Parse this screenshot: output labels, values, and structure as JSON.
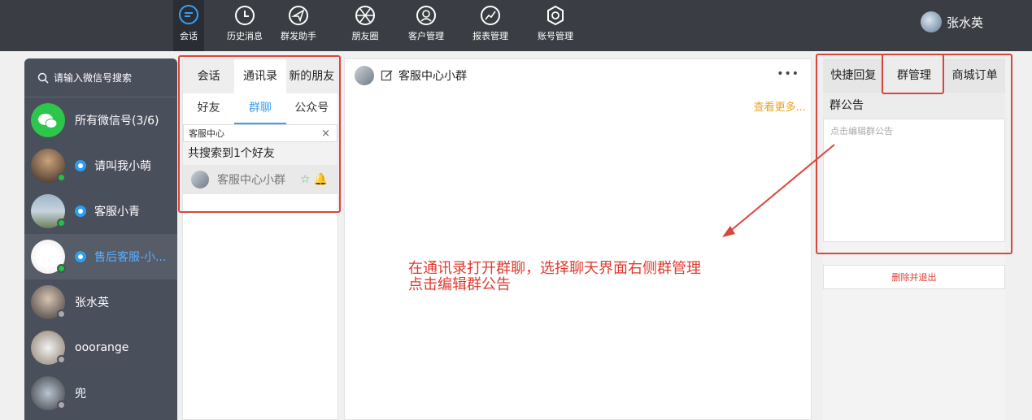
{
  "nav": {
    "items": [
      {
        "label": "会话",
        "icon": "chat-bubble-icon"
      },
      {
        "label": "历史消息",
        "icon": "clock-icon"
      },
      {
        "label": "群发助手",
        "icon": "send-icon"
      },
      {
        "label": "朋友圈",
        "icon": "aperture-icon"
      },
      {
        "label": "客户管理",
        "icon": "customer-icon"
      },
      {
        "label": "报表管理",
        "icon": "chart-icon"
      },
      {
        "label": "账号管理",
        "icon": "gear-icon"
      }
    ],
    "user_name": "张水英"
  },
  "sidebar": {
    "search_placeholder": "请输入微信号搜索",
    "accounts": [
      {
        "name": "所有微信号(3/6)"
      },
      {
        "name": "请叫我小萌"
      },
      {
        "name": "客服小青"
      },
      {
        "name": "售后客服-小..."
      },
      {
        "name": "张水英"
      },
      {
        "name": "ooorange"
      },
      {
        "name": "兜"
      }
    ]
  },
  "contacts": {
    "tabs": [
      "会话",
      "通讯录",
      "新的朋友"
    ],
    "subtabs": [
      "好友",
      "群聊",
      "公众号"
    ],
    "search_value": "客服中心",
    "clear": "×",
    "found_text": "共搜索到1个好友",
    "result_name": "客服中心小群"
  },
  "chat": {
    "title": "客服中心小群",
    "more": "•••",
    "see_more": "查看更多...",
    "annotation_line1": "在通讯录打开群聊，选择聊天界面右侧群管理",
    "annotation_line2": "点击编辑群公告"
  },
  "right_panel": {
    "tabs": [
      "快捷回复",
      "群管理",
      "商城订单"
    ],
    "announcement_title": "群公告",
    "announcement_placeholder": "点击编辑群公告",
    "delete_exit": "删除并退出"
  },
  "colors": {
    "annotation": "#d9463b",
    "accent_blue": "#3a9ff4",
    "online": "#1dc43f"
  }
}
